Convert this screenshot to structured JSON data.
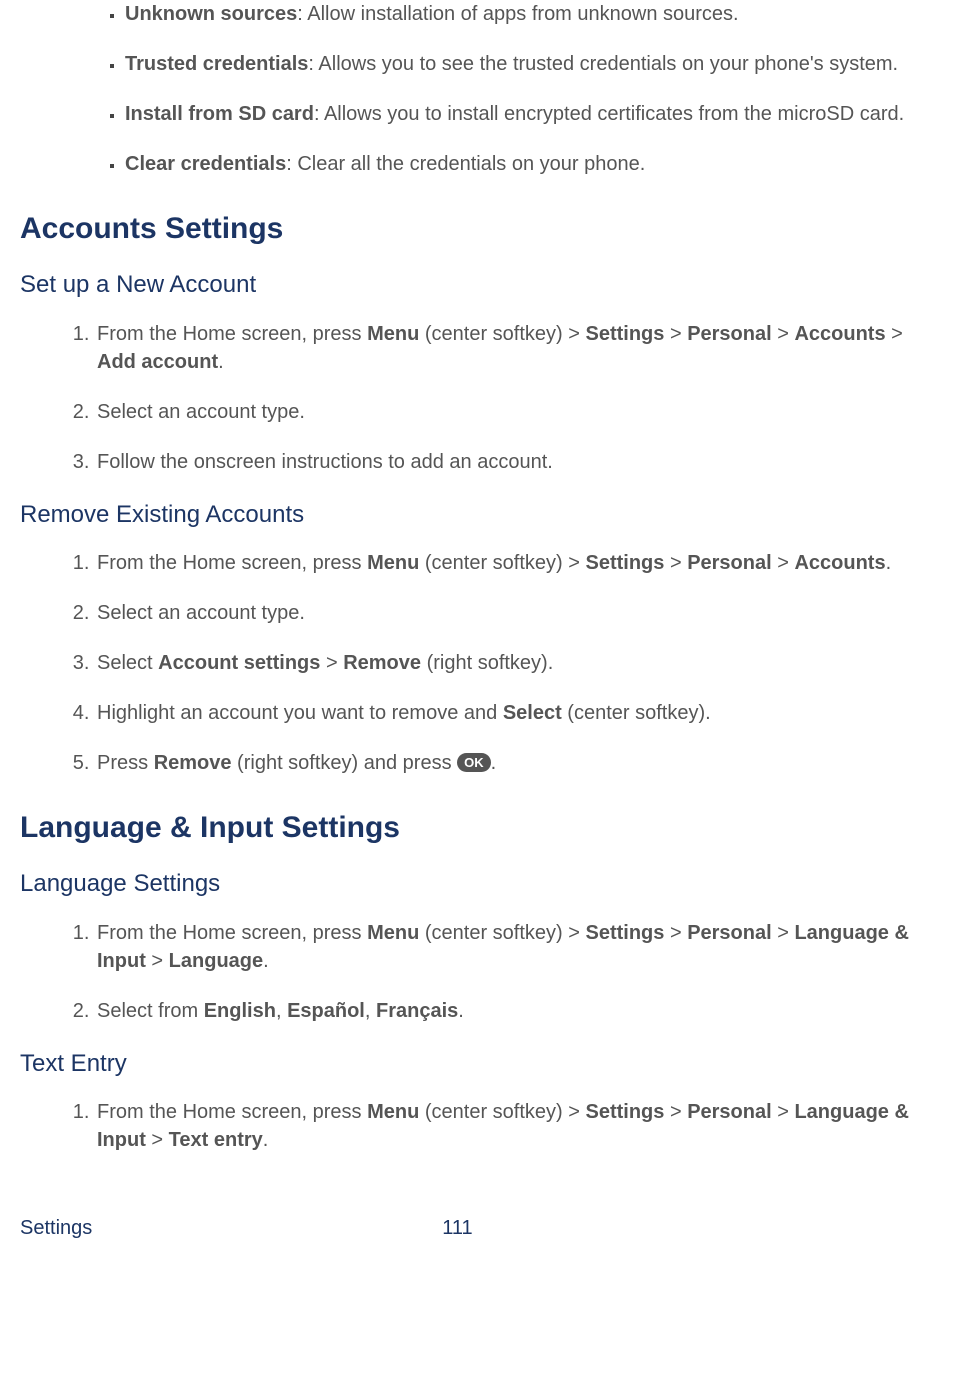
{
  "bullets": [
    {
      "term": "Unknown sources",
      "desc": ": Allow installation of apps from unknown sources."
    },
    {
      "term": "Trusted credentials",
      "desc": ": Allows you to see the trusted credentials on your phone's system."
    },
    {
      "term": "Install from SD card",
      "desc": ": Allows you to install encrypted certificates from the microSD card."
    },
    {
      "term": "Clear credentials",
      "desc": ": Clear all the credentials on your phone."
    }
  ],
  "section1": {
    "title": "Accounts Settings",
    "sub1": {
      "title": "Set up a New Account",
      "step1": {
        "t1": "From the Home screen, press ",
        "b1": "Menu",
        "t2": " (center softkey) > ",
        "b2": "Settings",
        "t3": " > ",
        "b3": "Personal",
        "t4": " > ",
        "b4": "Accounts",
        "t5": " > ",
        "b5": "Add account",
        "t6": "."
      },
      "step2": "Select an account type.",
      "step3": "Follow the onscreen instructions to add an account."
    },
    "sub2": {
      "title": "Remove Existing Accounts",
      "step1": {
        "t1": "From the Home screen, press ",
        "b1": "Menu",
        "t2": " (center softkey) > ",
        "b2": "Settings",
        "t3": " > ",
        "b3": "Personal",
        "t4": " > ",
        "b4": "Accounts",
        "t5": "."
      },
      "step2": "Select an account type.",
      "step3": {
        "t1": "Select ",
        "b1": "Account settings",
        "t2": " > ",
        "b2": "Remove",
        "t3": " (right softkey)."
      },
      "step4": {
        "t1": "Highlight an account you want to remove and ",
        "b1": "Select",
        "t2": " (center softkey)."
      },
      "step5": {
        "t1": "Press ",
        "b1": "Remove",
        "t2": " (right softkey) and press ",
        "icon": "OK",
        "t3": "."
      }
    }
  },
  "section2": {
    "title": "Language & Input Settings",
    "sub1": {
      "title": "Language Settings",
      "step1": {
        "t1": "From the Home screen, press ",
        "b1": "Menu",
        "t2": " (center softkey) > ",
        "b2": "Settings",
        "t3": " > ",
        "b3": "Personal",
        "t4": " > ",
        "b4": "Language & Input",
        "t5": " > ",
        "b5": "Language",
        "t6": "."
      },
      "step2": {
        "t1": "Select from ",
        "b1": "English",
        "t2": ", ",
        "b2": "Español",
        "t3": ", ",
        "b3": "Français",
        "t4": "."
      }
    },
    "sub2": {
      "title": "Text Entry",
      "step1": {
        "t1": "From the Home screen, press ",
        "b1": "Menu",
        "t2": " (center softkey) > ",
        "b2": "Settings",
        "t3": " > ",
        "b3": "Personal",
        "t4": " > ",
        "b4": "Language & Input",
        "t5": " > ",
        "b5": "Text entry",
        "t6": "."
      }
    }
  },
  "footer": {
    "section": "Settings",
    "page": "111"
  }
}
